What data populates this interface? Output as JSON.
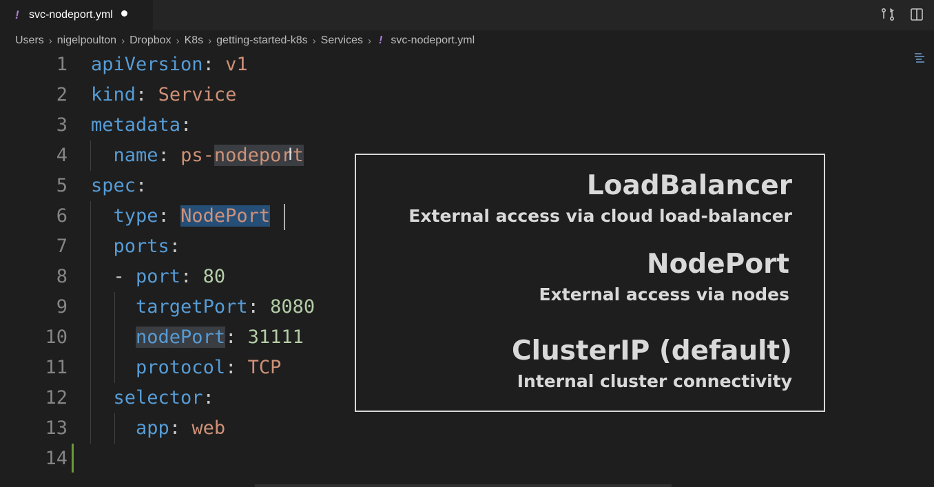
{
  "tab": {
    "label": "svc-nodeport.yml",
    "icon": "!"
  },
  "breadcrumb": [
    "Users",
    "nigelpoulton",
    "Dropbox",
    "K8s",
    "getting-started-k8s",
    "Services"
  ],
  "breadcrumb_file": "svc-nodeport.yml",
  "lines": [
    {
      "num": "1"
    },
    {
      "num": "2"
    },
    {
      "num": "3"
    },
    {
      "num": "4"
    },
    {
      "num": "5"
    },
    {
      "num": "6"
    },
    {
      "num": "7"
    },
    {
      "num": "8"
    },
    {
      "num": "9"
    },
    {
      "num": "10"
    },
    {
      "num": "11"
    },
    {
      "num": "12"
    },
    {
      "num": "13"
    },
    {
      "num": "14"
    }
  ],
  "code": {
    "l1_key": "apiVersion",
    "l1_val": "v1",
    "l2_key": "kind",
    "l2_val": "Service",
    "l3_key": "metadata",
    "l4_key": "name",
    "l4_val_a": "ps-",
    "l4_val_b": "nodeport",
    "l5_key": "spec",
    "l6_key": "type",
    "l6_val": "NodePort",
    "l7_key": "ports",
    "l8_dash": "- ",
    "l8_key": "port",
    "l8_val": "80",
    "l9_key": "targetPort",
    "l9_val": "8080",
    "l10_key": "nodePort",
    "l10_val": "31111",
    "l11_key": "protocol",
    "l11_val": "TCP",
    "l12_key": "selector",
    "l13_key": "app",
    "l13_val": "web",
    "colon": ":"
  },
  "overlay": {
    "items": [
      {
        "title": "LoadBalancer",
        "subtitle": "External access via cloud load-balancer"
      },
      {
        "title": "NodePort",
        "subtitle": "External access via nodes"
      },
      {
        "title": "ClusterIP (default)",
        "subtitle": "Internal cluster connectivity"
      }
    ]
  },
  "colors": {
    "keyword": "#569cd6",
    "string": "#ce9178",
    "number": "#b5cea8",
    "selection": "#264f78"
  }
}
